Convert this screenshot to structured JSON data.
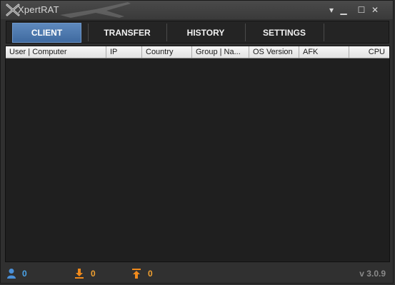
{
  "window": {
    "title": "XpertRAT",
    "controls": [
      "chevron-down-icon",
      "minimize-icon",
      "maximize-icon",
      "close-icon"
    ]
  },
  "tabs": [
    {
      "label": "CLIENT",
      "active": true
    },
    {
      "label": "TRANSFER",
      "active": false
    },
    {
      "label": "HISTORY",
      "active": false
    },
    {
      "label": "SETTINGS",
      "active": false
    }
  ],
  "table": {
    "columns": [
      "User | Computer",
      "IP",
      "Country",
      "Group | Na...",
      "OS Version",
      "AFK",
      "CPU"
    ],
    "rows": []
  },
  "status": {
    "clients_count": "0",
    "downloads_count": "0",
    "uploads_count": "0",
    "version": "v 3.0.9"
  },
  "colors": {
    "accent": "#4f7ab0",
    "clients_icon": "#4a90d9",
    "transfer_icon": "#f08a1c",
    "status_value_blue": "#4aa3e8",
    "status_value_orange": "#f0a030"
  }
}
